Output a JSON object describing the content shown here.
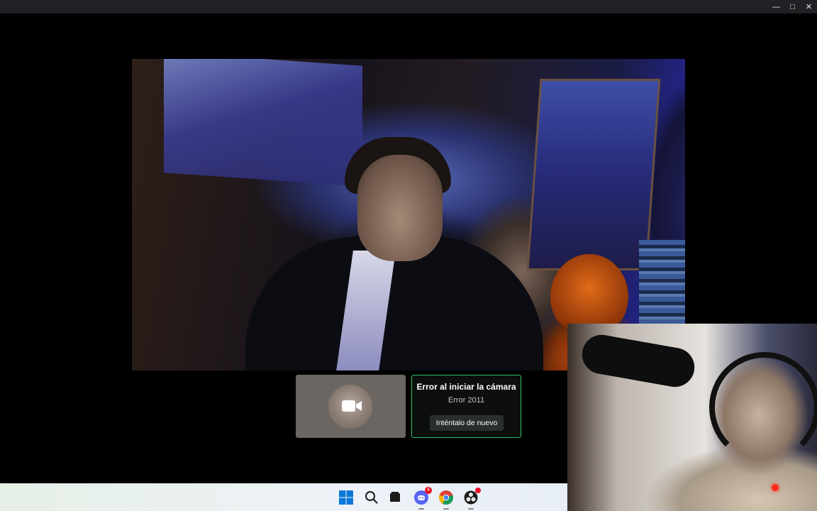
{
  "window": {
    "controls": [
      {
        "name": "minimize",
        "glyph": "—"
      },
      {
        "name": "maximize",
        "glyph": "□"
      },
      {
        "name": "close",
        "glyph": "✕"
      }
    ]
  },
  "self_view": {
    "camera_icon": "video-camera-icon"
  },
  "error_card": {
    "title": "Error al iniciar la cámara",
    "code": "Error 2011",
    "retry_label": "Inténtalo de nuevo",
    "accent": "#2fc36a"
  },
  "taskbar": {
    "items": [
      {
        "name": "start",
        "icon": "windows-logo-icon"
      },
      {
        "name": "search",
        "icon": "search-icon"
      },
      {
        "name": "task-view",
        "icon": "task-view-icon"
      },
      {
        "name": "discord",
        "icon": "discord-icon",
        "badge": "4"
      },
      {
        "name": "chrome",
        "icon": "chrome-icon"
      },
      {
        "name": "obs",
        "icon": "obs-icon",
        "notification_dot": true
      }
    ]
  },
  "webcam_overlay": {
    "live_indicator_color": "#ff2a1e"
  }
}
